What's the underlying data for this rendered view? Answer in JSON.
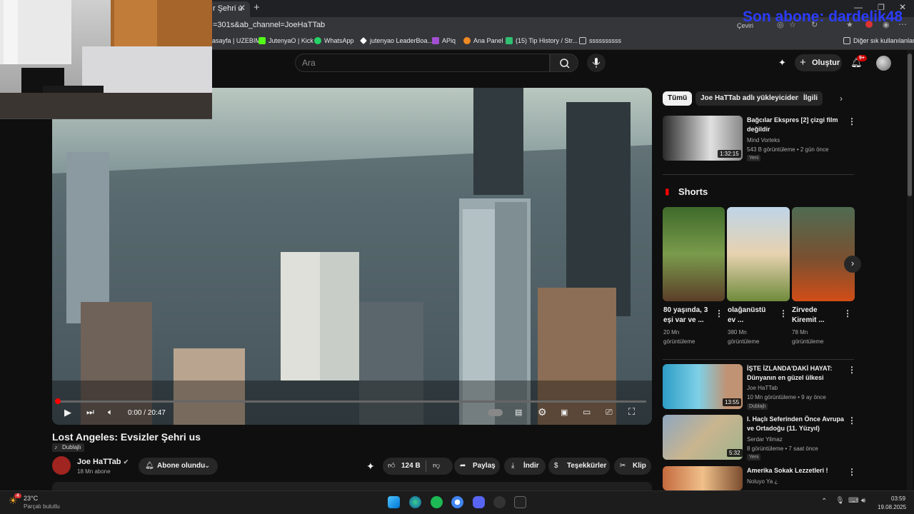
{
  "browser": {
    "tab_title": "r Şehri u",
    "url": "=301s&ab_channel=JoeHaTTab",
    "translate_btn": "Çeviri",
    "bookmarks": [
      "asayfa | UZEBIM",
      "JutenyaO | Kick",
      "WhatsApp",
      "jutenyao LeaderBoa...",
      "APiq",
      "Ana Panel",
      "(15) Tip History / Str...",
      "ssssssssss"
    ],
    "other_bookmarks": "Diğer sık kullanılanlar",
    "colors": {
      "chrome_bg": "#35363a",
      "tab_bg": "#202124"
    }
  },
  "stream_overlay": {
    "last_sub": "Son abone: dardelik48"
  },
  "youtube": {
    "search_placeholder": "Ara",
    "create_label": "Oluştur",
    "notif_count": "9+",
    "video": {
      "time": "0:00 / 20:47",
      "title": "Lost Angeles: Evsizler Şehri us",
      "dub_label": "Dublajlı",
      "channel": "Joe HaTTab",
      "subscribers": "18 Mn abone",
      "subscribe_label": "Abone olundu",
      "likes": "124 B",
      "share": "Paylaş",
      "download": "İndir",
      "thanks": "Teşekkürler",
      "clip": "Klip",
      "progress": 0.0
    },
    "chips": [
      "Tümü",
      "Joe HaTTab adlı yükleyiciden",
      "İlgili"
    ],
    "recs": [
      {
        "title1": "Bağcılar Ekspres [2] çizgi film",
        "title2": "değildir",
        "channel": "Mind Vorteks",
        "meta": "543 B görüntüleme • 2 gün önce",
        "badge": "Yeni",
        "duration": "1:32:15"
      },
      {
        "title1": "İŞTE İZLANDA'DAKİ HAYAT:",
        "title2": "Dünyanın en güzel ülkesi",
        "channel": "Joe HaTTab",
        "meta": "10 Mn görüntüleme • 9 ay önce",
        "badge": "Dublajlı",
        "duration": "13:55"
      },
      {
        "title1": "I. Haçlı Seferinden Önce Avrupa",
        "title2": "ve Ortadoğu (11. Yüzyıl)",
        "channel": "Serdar Yilmaz",
        "meta": "8 görüntüleme • 7 saat önce",
        "badge": "Yeni",
        "duration": "5:32"
      },
      {
        "title1": "Amerika Sokak Lezzetleri !",
        "title2": "",
        "channel": "Noluyo Ya ¿",
        "meta": "",
        "badge": "",
        "duration": ""
      }
    ],
    "shorts_label": "Shorts",
    "shorts": [
      {
        "t1": "80 yaşında, 3",
        "t2": "eşi var ve ...",
        "v1": "20 Mn",
        "v2": "görüntüleme"
      },
      {
        "t1": "olağanüstü",
        "t2": "ev ...",
        "v1": "380 Mn",
        "v2": "görüntüleme"
      },
      {
        "t1": "Zirvede",
        "t2": "Kiremit ...",
        "v1": "78 Mn",
        "v2": "görüntüleme"
      }
    ]
  },
  "taskbar": {
    "weather_temp": "23°C",
    "weather_desc": "Parçalı bulutlu",
    "weather_badge": "4",
    "time": "03:59",
    "date": "19.08.2025"
  }
}
